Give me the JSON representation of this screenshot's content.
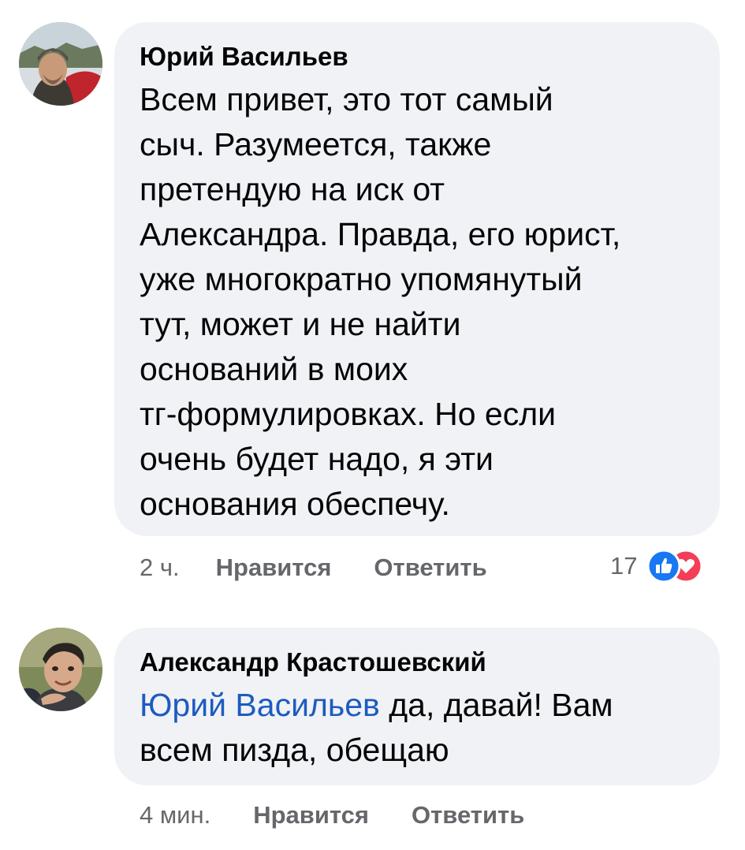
{
  "comments": [
    {
      "author": "Юрий Васильев",
      "text": "Всем привет, это тот самый\nсыч. Разумеется, также\nпретендую на иск от\nАлександра. Правда, его юрист,\nуже многократно упомянутый\nтут, может и не найти\nоснований в моих\nтг-формулировках. Но если\nочень будет надо, я эти\nоснования обеспечу.",
      "time": "2 ч.",
      "like_label": "Нравится",
      "reply_label": "Ответить",
      "reaction_count": "17",
      "reaction_icons": [
        "like-icon",
        "love-icon"
      ]
    },
    {
      "author": "Александр Крастошевский",
      "mention": "Юрий Васильев",
      "text_after_mention": " да, давай! Вам\nвсем пизда, обещаю",
      "time": "4 мин.",
      "like_label": "Нравится",
      "reply_label": "Ответить"
    }
  ],
  "colors": {
    "bubble": "#f0f2f5",
    "secondary_text": "#65676b",
    "mention": "#1d5bbf",
    "like_blue": "#1877f2",
    "love_red": "#f33e58"
  }
}
